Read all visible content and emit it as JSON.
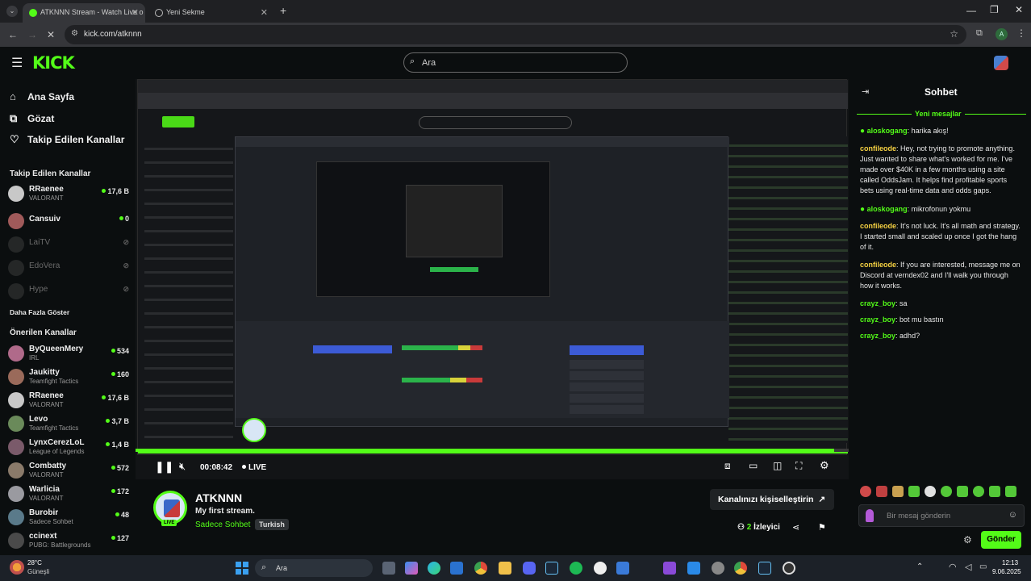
{
  "browser": {
    "tabs": [
      {
        "label": "ATKNNN Stream - Watch Live o",
        "active": true
      },
      {
        "label": "Yeni Sekme",
        "active": false
      }
    ],
    "new_tab": "+",
    "url": "kick.com/atknnn"
  },
  "header": {
    "logo": "KICK",
    "search_placeholder": "Ara"
  },
  "sidebar": {
    "nav": [
      {
        "label": "Ana Sayfa",
        "icon": "home-icon"
      },
      {
        "label": "Gözat",
        "icon": "browse-icon"
      },
      {
        "label": "Takip Edilen Kanallar",
        "icon": "heart-icon"
      }
    ],
    "followed_title": "Takip Edilen Kanallar",
    "followed": [
      {
        "name": "RRaenee",
        "game": "VALORANT",
        "viewers": "17,6 B",
        "online": true
      },
      {
        "name": "Cansuiv",
        "game": "",
        "viewers": "0",
        "online": true
      },
      {
        "name": "LaiTV",
        "game": "",
        "viewers": "",
        "online": false
      },
      {
        "name": "EdoVera",
        "game": "",
        "viewers": "",
        "online": false
      },
      {
        "name": "Hype",
        "game": "",
        "viewers": "",
        "online": false
      }
    ],
    "show_more": "Daha Fazla Göster",
    "recommended_title": "Önerilen Kanallar",
    "recommended": [
      {
        "name": "ByQueenMery",
        "game": "IRL",
        "viewers": "534"
      },
      {
        "name": "Jaukitty",
        "game": "Teamfight Tactics",
        "viewers": "160"
      },
      {
        "name": "RRaenee",
        "game": "VALORANT",
        "viewers": "17,6 B"
      },
      {
        "name": "Levo",
        "game": "Teamfight Tactics",
        "viewers": "3,7 B"
      },
      {
        "name": "LynxCerezLoL",
        "game": "League of Legends",
        "viewers": "1,4 B"
      },
      {
        "name": "Combatty",
        "game": "VALORANT",
        "viewers": "572"
      },
      {
        "name": "Warlicia",
        "game": "VALORANT",
        "viewers": "172"
      },
      {
        "name": "Burobir",
        "game": "Sadece Sohbet",
        "viewers": "48"
      },
      {
        "name": "ccinext",
        "game": "PUBG: Battlegrounds",
        "viewers": "127"
      }
    ]
  },
  "player": {
    "time": "00:08:42",
    "live_label": "LIVE",
    "progress": 0.98
  },
  "channel": {
    "name": "ATKNNN",
    "title": "My first stream.",
    "category": "Sadece Sohbet",
    "tag": "Turkish",
    "live_badge": "LIVE",
    "customize_label": "Kanalınızı kişiselleştirin",
    "viewers_count": "2",
    "viewers_label": "İzleyici"
  },
  "chat": {
    "title": "Sohbet",
    "new_messages": "Yeni mesajlar",
    "messages": [
      {
        "user": "aloskogang",
        "text": "harika akış!",
        "badge": true,
        "color": "g"
      },
      {
        "user": "confileode",
        "text": "Hey, not trying to promote anything. Just wanted to share what's worked for me. I've made over $40K in a few months using a site called OddsJam. It helps find profitable sports bets using real-time data and odds gaps.",
        "badge": false,
        "color": "y"
      },
      {
        "user": "aloskogang",
        "text": "mikrofonun yokmu",
        "badge": true,
        "color": "g"
      },
      {
        "user": "confileode",
        "text": "It's not luck. It's all math and strategy. I started small and scaled up once I got the hang of it.",
        "badge": false,
        "color": "y"
      },
      {
        "user": "confileode",
        "text": "If you are interested, message me on Discord at verndex02 and I'll walk you through how it works.",
        "badge": false,
        "color": "y"
      },
      {
        "user": "crayz_boy",
        "text": "sa",
        "badge": false,
        "color": "g"
      },
      {
        "user": "crayz_boy",
        "text": "bot mu bastın",
        "badge": false,
        "color": "g"
      },
      {
        "user": "crayz_boy",
        "text": "adhd?",
        "badge": false,
        "color": "g"
      }
    ],
    "input_placeholder": "Bir mesaj gönderin",
    "send_label": "Gönder"
  },
  "taskbar": {
    "weather_temp": "28°C",
    "weather_desc": "Güneşli",
    "search_placeholder": "Ara",
    "time": "12:13",
    "date": "9.06.2025"
  },
  "colors": {
    "accent": "#53fc18",
    "background": "#0b0e0f",
    "taskbar": "#1c2128"
  }
}
